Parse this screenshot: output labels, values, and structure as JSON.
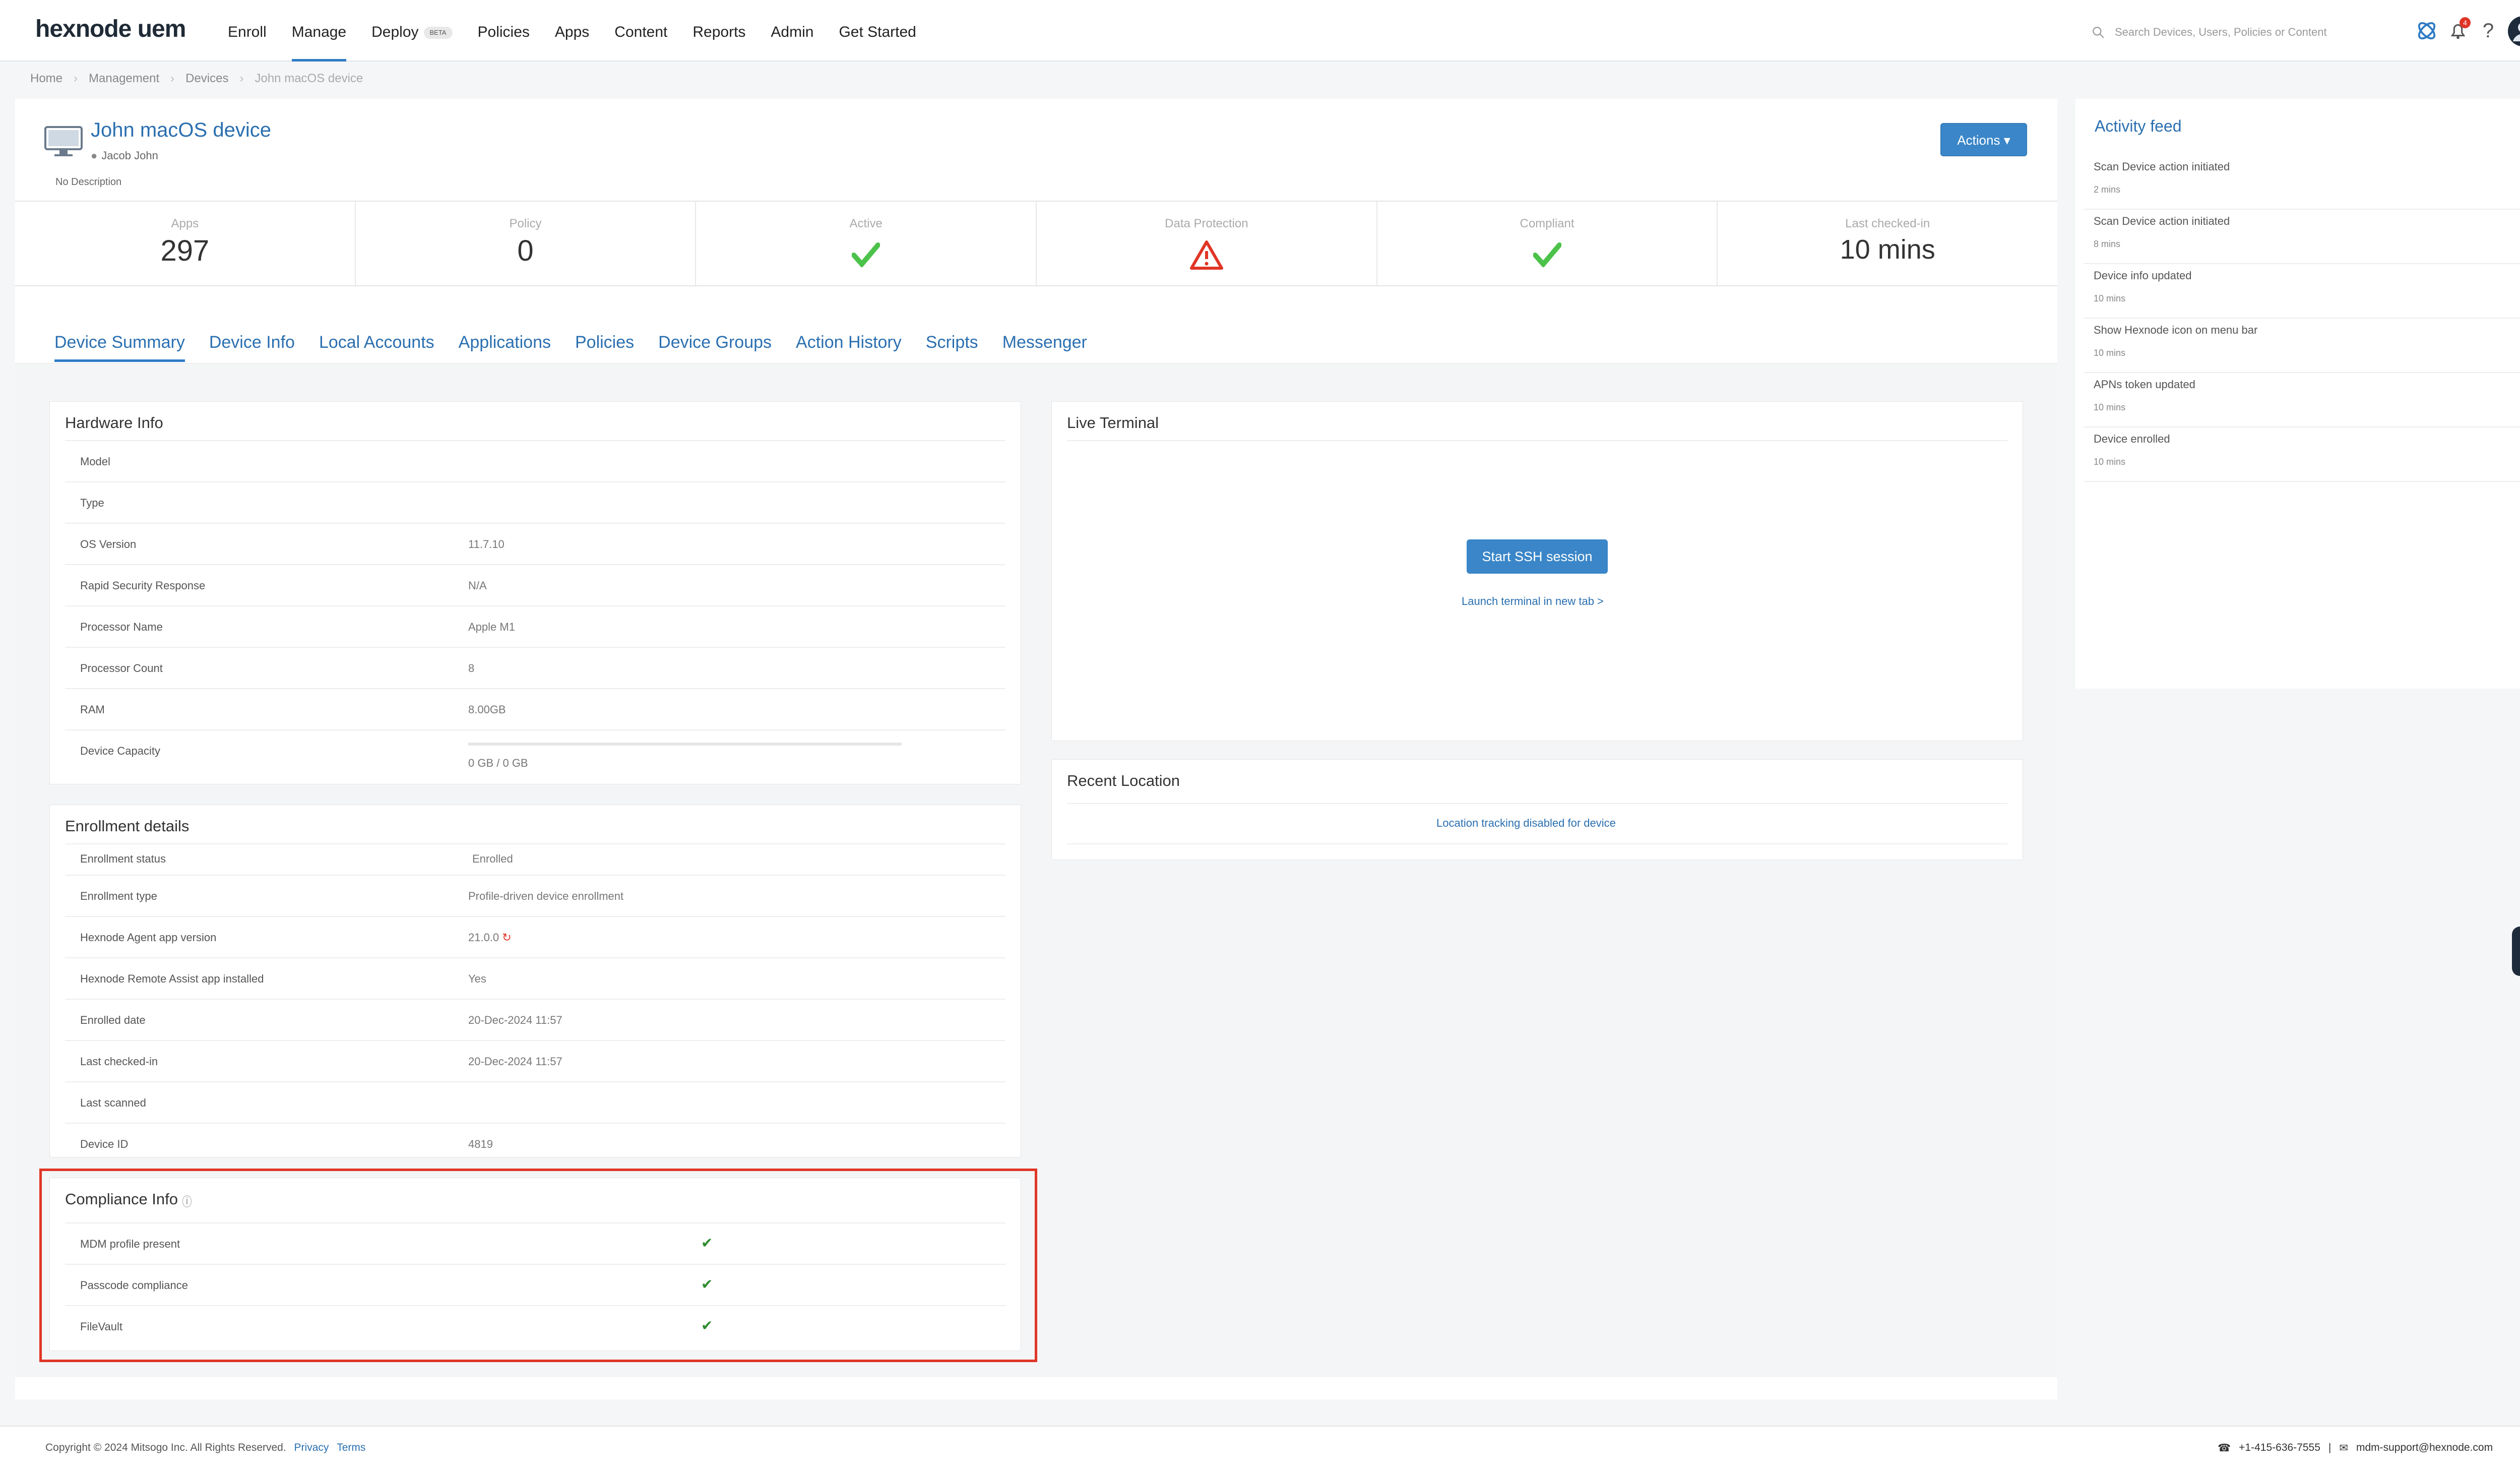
{
  "header": {
    "logo": "hexnode uem",
    "nav": [
      {
        "label": "Enroll"
      },
      {
        "label": "Manage",
        "active": true
      },
      {
        "label": "Deploy",
        "badge": "BETA"
      },
      {
        "label": "Policies"
      },
      {
        "label": "Apps"
      },
      {
        "label": "Content"
      },
      {
        "label": "Reports"
      },
      {
        "label": "Admin"
      },
      {
        "label": "Get Started"
      }
    ],
    "search_placeholder": "Search Devices, Users, Policies or Content",
    "notification_count": "4"
  },
  "breadcrumb": [
    "Home",
    "Management",
    "Devices",
    "John macOS device"
  ],
  "device": {
    "name": "John macOS device",
    "owner": "Jacob John",
    "description": "No Description",
    "actions_label": "Actions"
  },
  "stats": [
    {
      "label": "Apps",
      "value": "297"
    },
    {
      "label": "Policy",
      "value": "0"
    },
    {
      "label": "Active",
      "icon": "check-icon"
    },
    {
      "label": "Data Protection",
      "icon": "warning-icon"
    },
    {
      "label": "Compliant",
      "icon": "check-icon"
    },
    {
      "label": "Last checked-in",
      "value": "10 mins"
    }
  ],
  "tabs": [
    "Device Summary",
    "Device Info",
    "Local Accounts",
    "Applications",
    "Policies",
    "Device Groups",
    "Action History",
    "Scripts",
    "Messenger"
  ],
  "hardware": {
    "title": "Hardware Info",
    "rows": [
      {
        "k": "Model",
        "v": ""
      },
      {
        "k": "Type",
        "v": ""
      },
      {
        "k": "OS Version",
        "v": "11.7.10"
      },
      {
        "k": "Rapid Security Response",
        "v": "N/A"
      },
      {
        "k": "Processor Name",
        "v": "Apple M1"
      },
      {
        "k": "Processor Count",
        "v": "8"
      },
      {
        "k": "RAM",
        "v": "8.00GB"
      },
      {
        "k": "Device Capacity",
        "v": "0 GB / 0 GB"
      }
    ]
  },
  "enrollment": {
    "title": "Enrollment details",
    "rows": [
      {
        "k": "Enrollment status",
        "v": "Enrolled"
      },
      {
        "k": "Enrollment type",
        "v": "Profile-driven device enrollment"
      },
      {
        "k": "Hexnode Agent app version",
        "v": "21.0.0"
      },
      {
        "k": "Hexnode Remote Assist app installed",
        "v": "Yes"
      },
      {
        "k": "Enrolled date",
        "v": "20-Dec-2024 11:57"
      },
      {
        "k": "Last checked-in",
        "v": "20-Dec-2024 11:57"
      },
      {
        "k": "Last scanned",
        "v": ""
      },
      {
        "k": "Device ID",
        "v": "4819"
      }
    ]
  },
  "compliance": {
    "title": "Compliance Info",
    "rows": [
      {
        "k": "MDM profile present",
        "ok": true
      },
      {
        "k": "Passcode compliance",
        "ok": true
      },
      {
        "k": "FileVault",
        "ok": true
      }
    ]
  },
  "terminal": {
    "title": "Live Terminal",
    "button": "Start SSH session",
    "link": "Launch terminal in new tab >"
  },
  "location": {
    "title": "Recent Location",
    "text": "Location tracking disabled for device"
  },
  "activity": {
    "title": "Activity feed",
    "items": [
      {
        "text": "Scan Device action initiated",
        "time": "2 mins"
      },
      {
        "text": "Scan Device action initiated",
        "time": "8 mins"
      },
      {
        "text": "Device info updated",
        "time": "10 mins"
      },
      {
        "text": "Show Hexnode icon on menu bar",
        "time": "10 mins"
      },
      {
        "text": "APNs token updated",
        "time": "10 mins"
      },
      {
        "text": "Device enrolled",
        "time": "10 mins"
      }
    ]
  },
  "footer": {
    "copyright": "Copyright © 2024 Mitsogo Inc. All Rights Reserved.",
    "privacy": "Privacy",
    "terms": "Terms",
    "phone": "+1-415-636-7555",
    "email": "mdm-support@hexnode.com"
  },
  "colors": {
    "accent": "#2f7bc4",
    "success": "#4cc24a",
    "danger": "#e03526"
  }
}
